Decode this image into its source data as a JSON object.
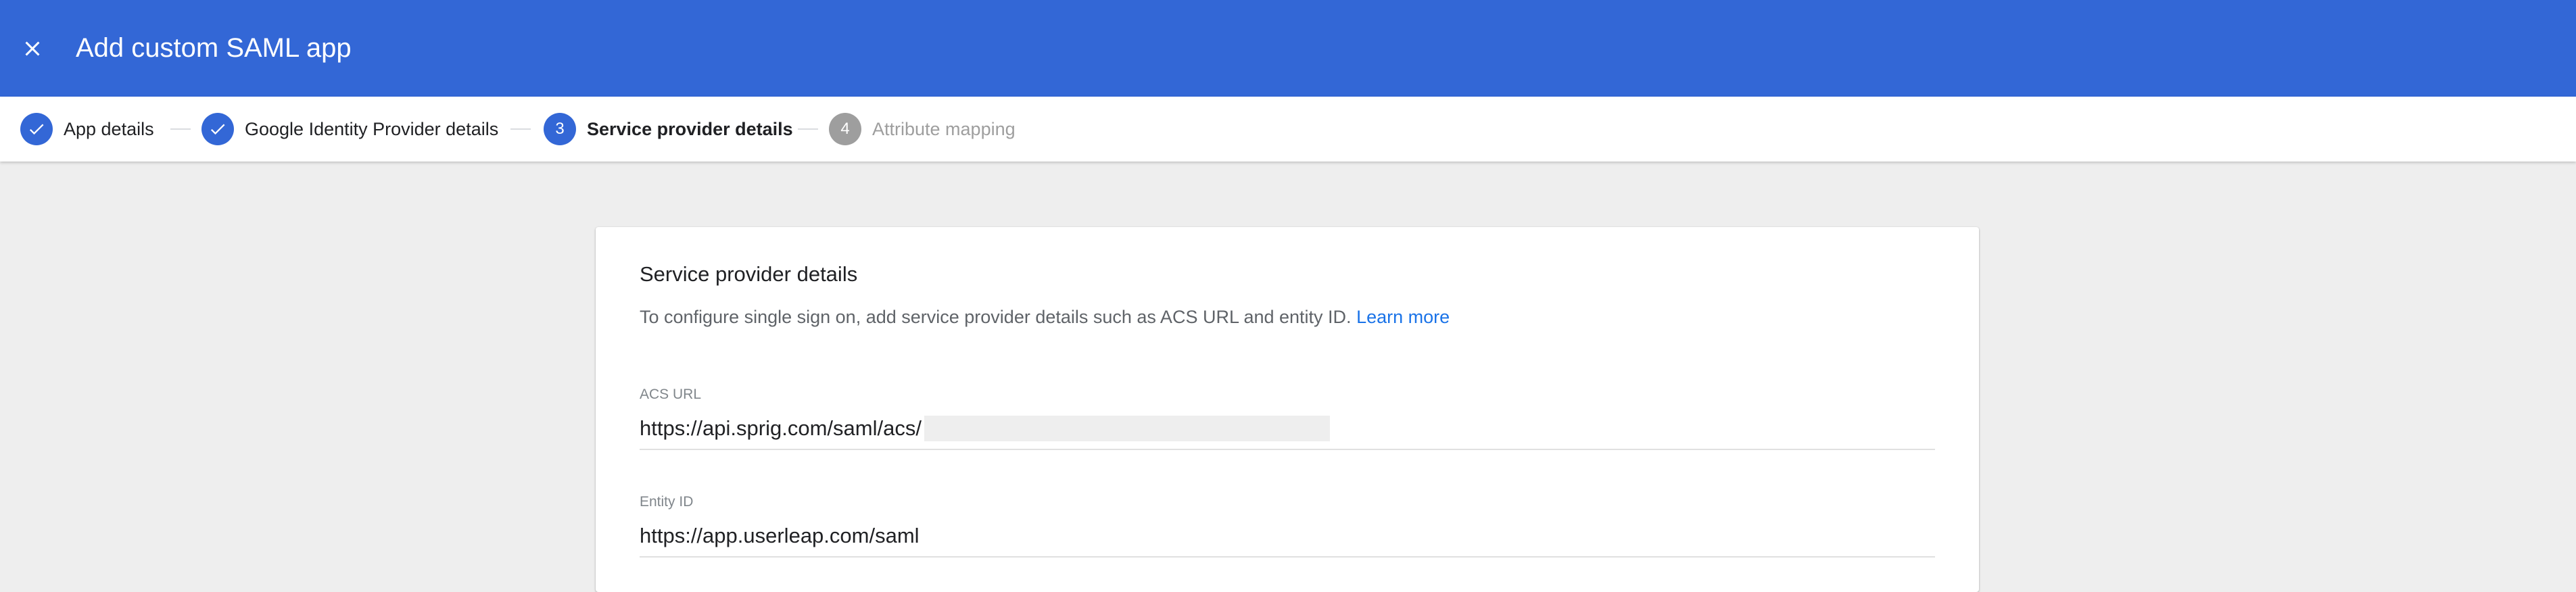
{
  "header": {
    "title": "Add custom SAML app",
    "close_icon": "close-icon",
    "background": "#3367d6"
  },
  "stepper": {
    "steps": [
      {
        "label": "App details",
        "status": "done",
        "number": ""
      },
      {
        "label": "Google Identity Provider details",
        "status": "done",
        "number": ""
      },
      {
        "label": "Service provider details",
        "status": "active",
        "number": "3"
      },
      {
        "label": "Attribute mapping",
        "status": "todo",
        "number": "4"
      }
    ]
  },
  "card": {
    "title": "Service provider details",
    "description": "To configure single sign on, add service provider details such as ACS URL and entity ID.",
    "learn_more": "Learn more",
    "fields": [
      {
        "label": "ACS URL",
        "value": "https://api.sprig.com/saml/acs/"
      },
      {
        "label": "Entity ID",
        "value": "https://app.userleap.com/saml"
      }
    ]
  }
}
